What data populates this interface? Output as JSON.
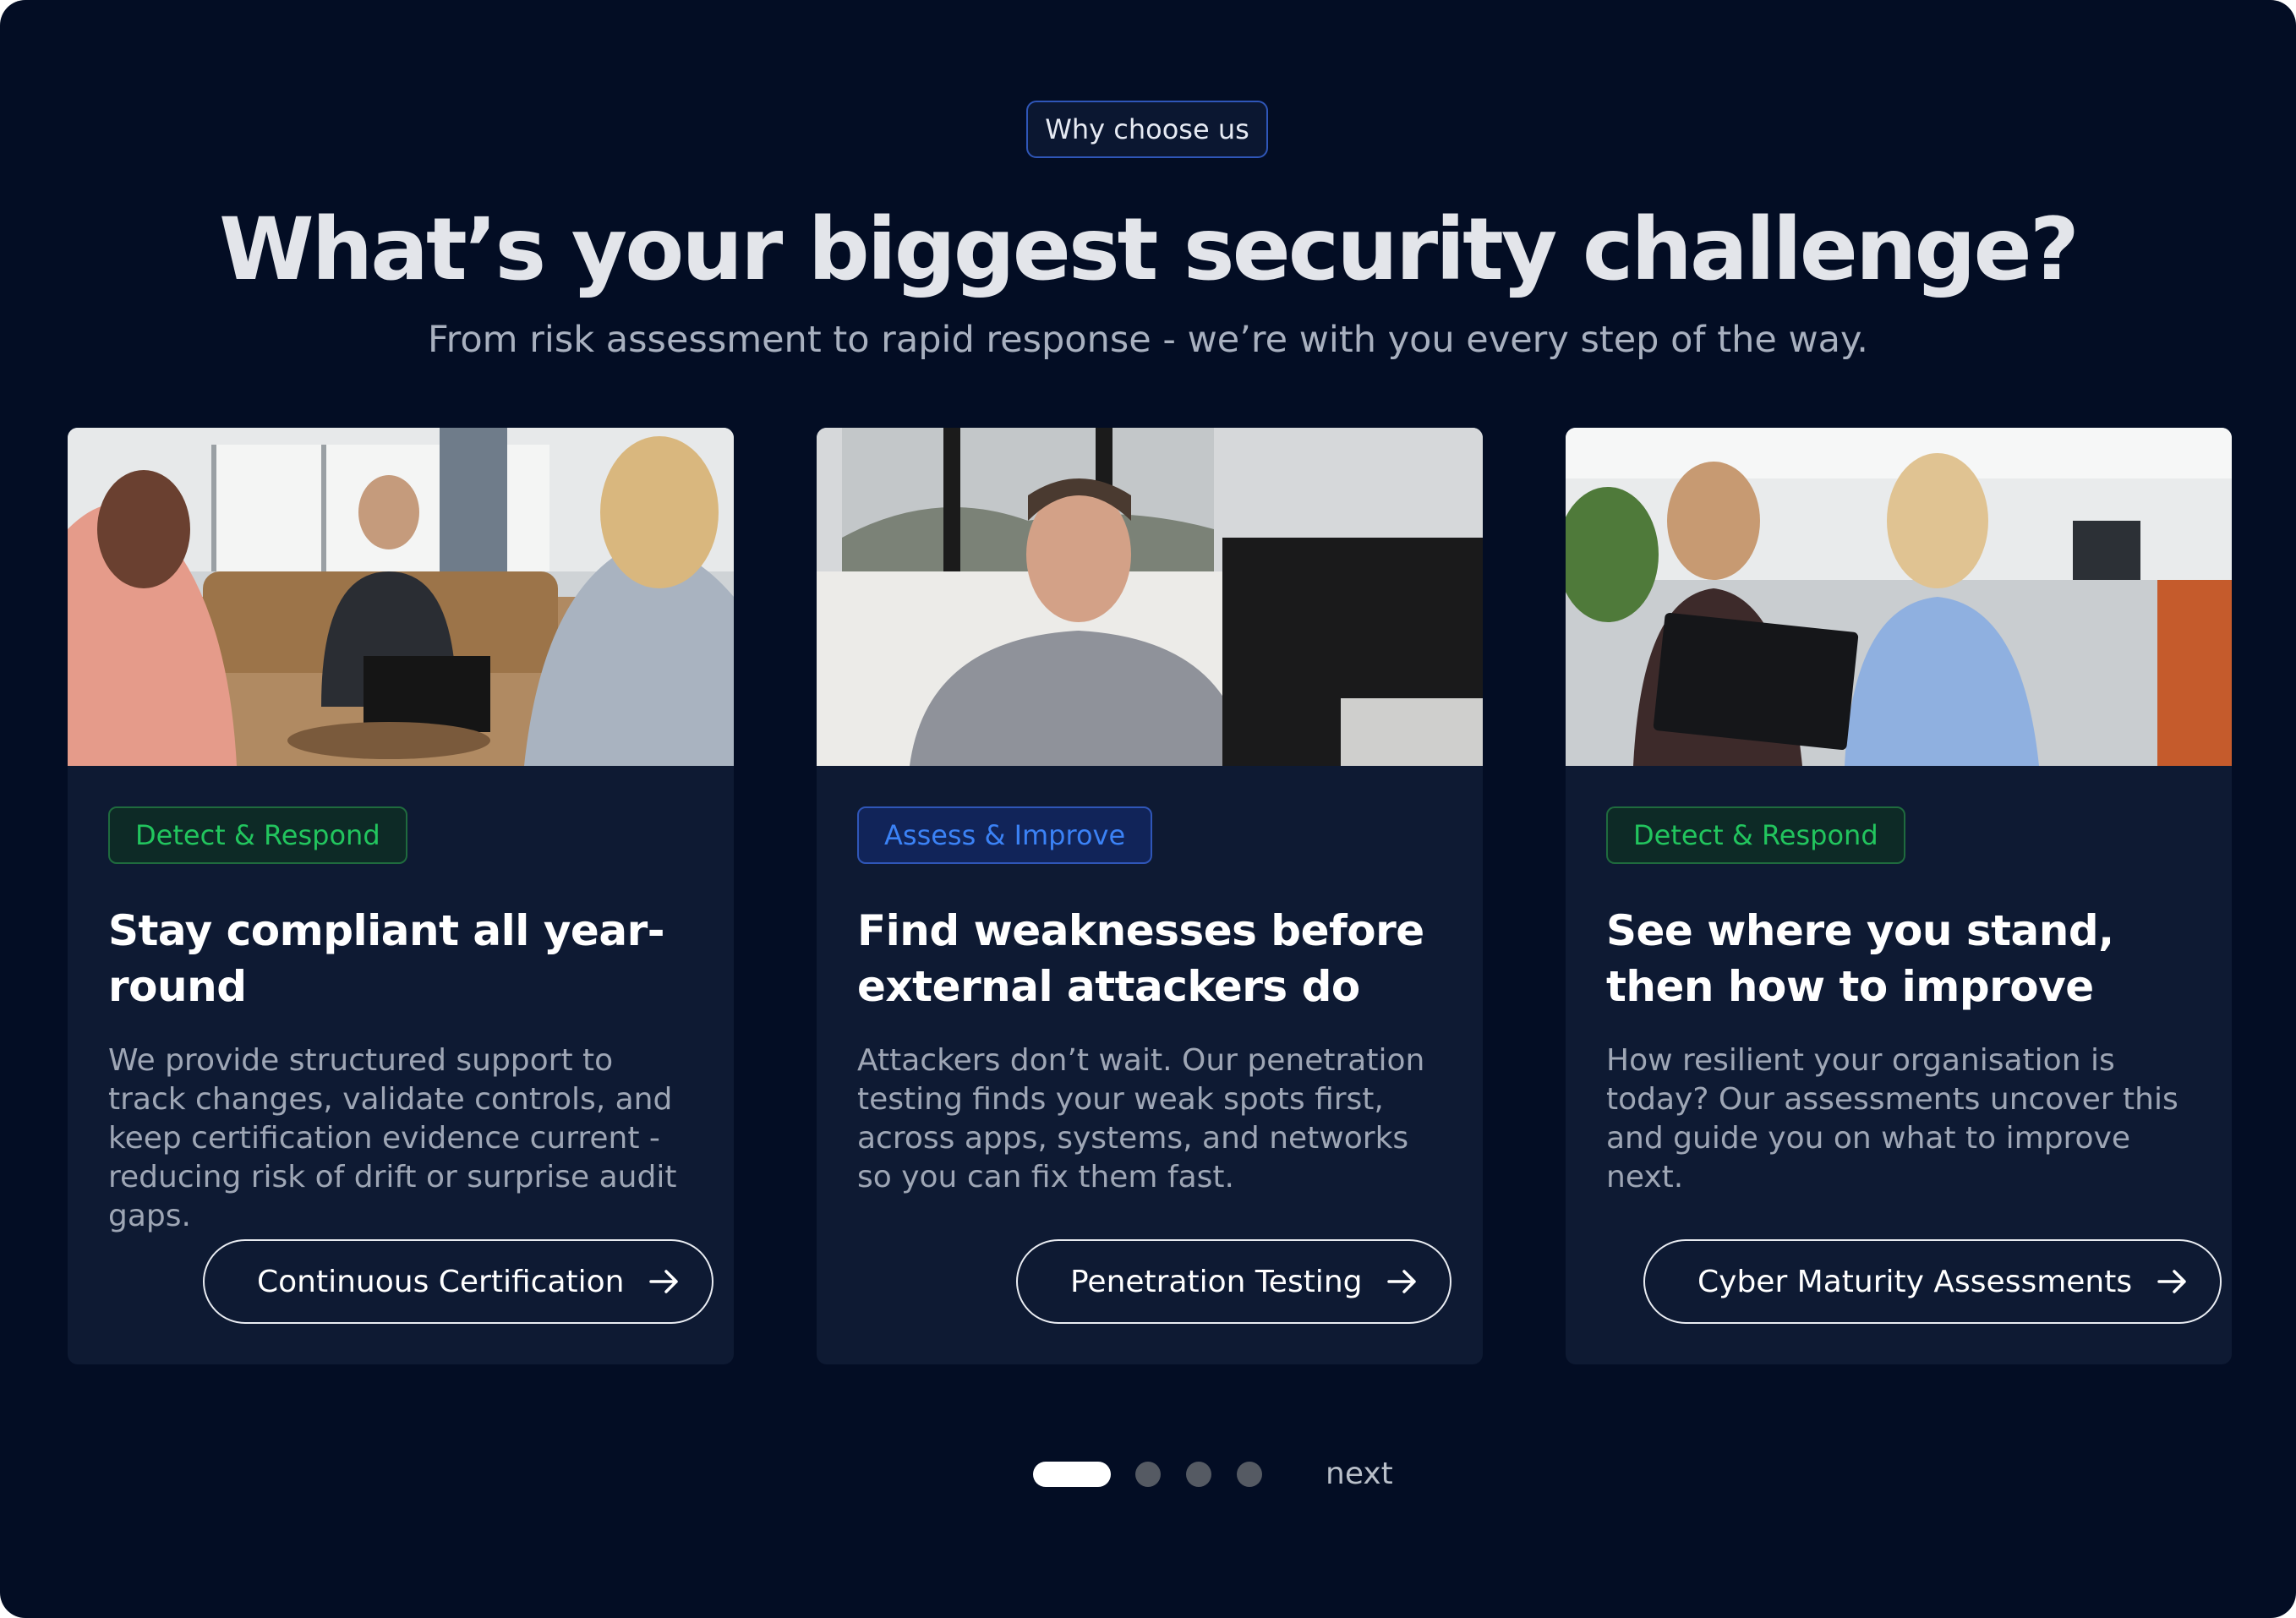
{
  "header": {
    "eyebrow": "Why choose us",
    "title": "What’s your biggest security challenge?",
    "subtitle": "From risk assessment to rapid response - we’re with you every step of the way."
  },
  "cards": [
    {
      "tag": "Detect & Respond",
      "tag_color": "#22c55e",
      "title": "Stay compliant all year-round",
      "description": "We provide structured support to track changes, validate controls, and keep certification evidence current - reducing risk of drift or surprise audit gaps.",
      "cta": "Continuous Certification",
      "cta_icon": "arrow-right-icon"
    },
    {
      "tag": "Assess & Improve",
      "tag_color": "#3b82f6",
      "title": "Find weaknesses before external attackers do",
      "description": "Attackers don’t wait. Our penetration testing finds your weak spots first, across apps, systems, and networks so you can fix them fast.",
      "cta": "Penetration Testing",
      "cta_icon": "arrow-right-icon"
    },
    {
      "tag": "Detect & Respond",
      "tag_color": "#22c55e",
      "title": "See where you stand, then how to improve",
      "description": "How resilient your organisation is today? Our assessments uncover this and guide you on what to improve next.",
      "cta": "Cyber Maturity Assessments",
      "cta_icon": "arrow-right-icon"
    }
  ],
  "pager": {
    "total": 4,
    "current": 1,
    "next_label": "next"
  },
  "colors": {
    "background": "#030d24",
    "card": "#0e1a33",
    "accent_green": "#22c55e",
    "accent_blue": "#3b82f6"
  }
}
